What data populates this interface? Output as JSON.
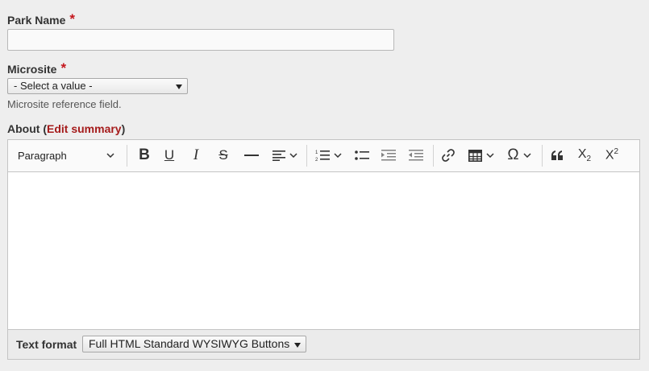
{
  "park_name": {
    "label": "Park Name",
    "required_mark": "*",
    "value": ""
  },
  "microsite": {
    "label": "Microsite",
    "required_mark": "*",
    "selected": "- Select a value -",
    "description": "Microsite reference field."
  },
  "about": {
    "label": "About",
    "paren_open": "(",
    "edit_summary_link": "Edit summary",
    "paren_close": ")",
    "toolbar": {
      "paragraph_format": "Paragraph",
      "icons": [
        "bold-icon",
        "underline-icon",
        "italic-icon",
        "strikethrough-icon",
        "horizontal-line-icon",
        "align-icon",
        "numbered-list-icon",
        "bulleted-list-icon",
        "indent-icon",
        "outdent-icon",
        "link-icon",
        "table-icon",
        "special-characters-icon",
        "blockquote-icon",
        "subscript-icon",
        "superscript-icon"
      ],
      "omega": "Ω",
      "subscript": "X₂",
      "superscript": "X²"
    },
    "content": "",
    "text_format": {
      "label": "Text format",
      "selected": "Full HTML Standard WYSIWYG Buttons"
    }
  }
}
